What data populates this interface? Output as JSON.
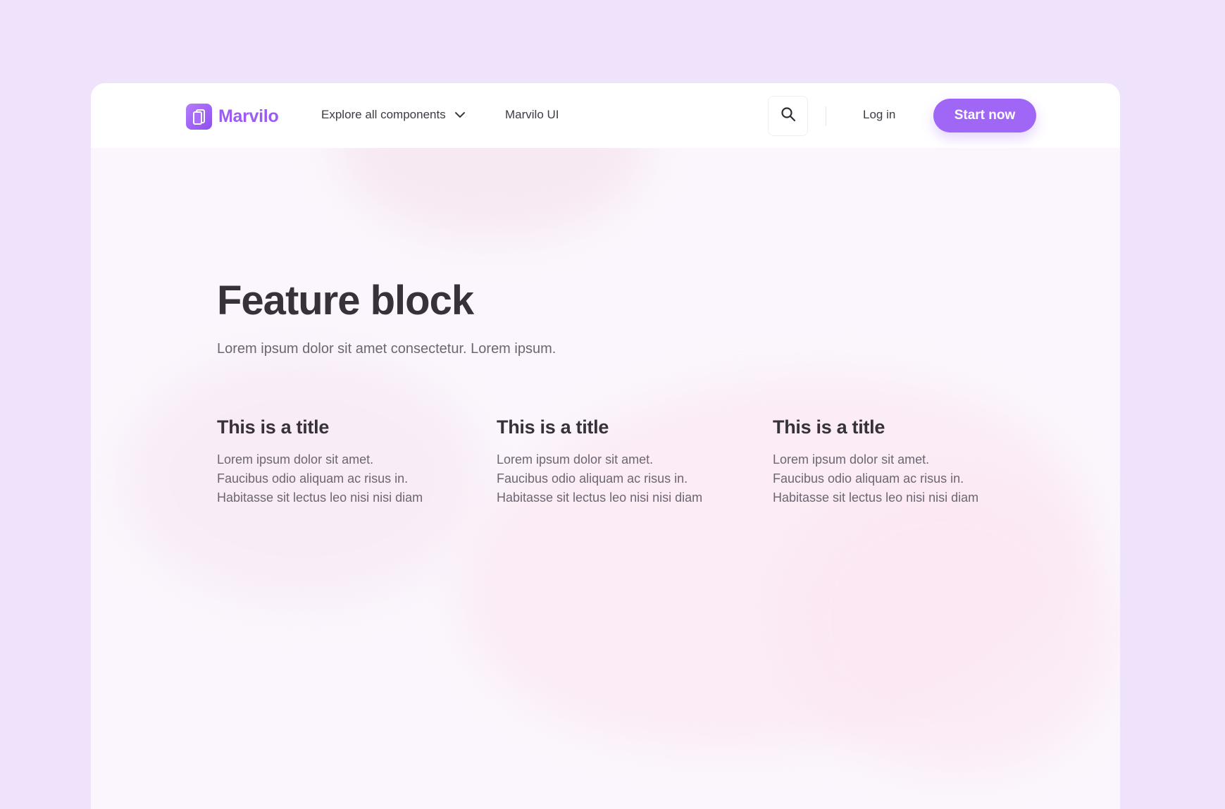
{
  "brand": {
    "name": "Marvilo",
    "icon": "cards-icon",
    "color": "#9a5cf3"
  },
  "nav": {
    "explore_label": "Explore all components",
    "ui_label": "Marvilo UI",
    "login_label": "Log in",
    "cta_label": "Start now",
    "cta_color": "#a066f5"
  },
  "hero": {
    "title": "Feature block",
    "subtitle": "Lorem ipsum dolor sit amet consectetur. Lorem ipsum."
  },
  "features": [
    {
      "title": "This is a title",
      "lines": [
        "Lorem ipsum dolor sit amet.",
        "Faucibus odio aliquam ac risus in.",
        "Habitasse sit lectus leo nisi nisi diam"
      ]
    },
    {
      "title": "This is a title",
      "lines": [
        "Lorem ipsum dolor sit amet.",
        "Faucibus odio aliquam ac risus in.",
        "Habitasse sit lectus leo nisi nisi diam"
      ]
    },
    {
      "title": "This is a title",
      "lines": [
        "Lorem ipsum dolor sit amet.",
        "Faucibus odio aliquam ac risus in.",
        "Habitasse sit lectus leo nisi nisi diam"
      ]
    }
  ]
}
